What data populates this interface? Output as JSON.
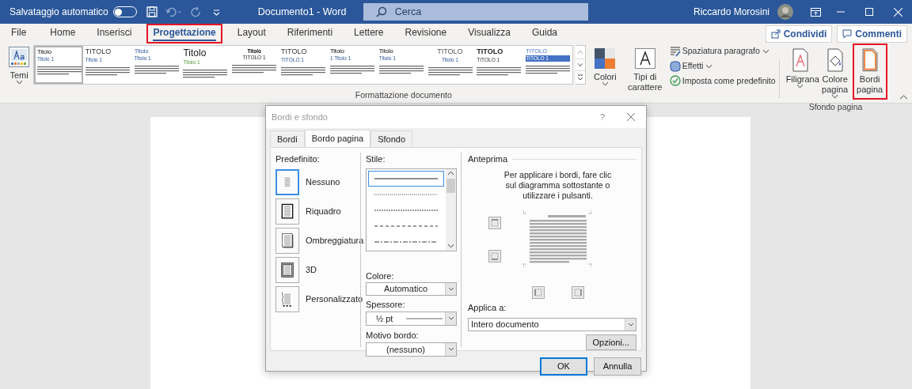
{
  "title_bar": {
    "autosave_label": "Salvataggio automatico",
    "autosave_on": false,
    "document_title": "Documento1 - Word",
    "search_placeholder": "Cerca",
    "user_name": "Riccardo Morosini"
  },
  "ribbon_tabs": [
    {
      "label": "File",
      "selected": false,
      "highlighted": false
    },
    {
      "label": "Home",
      "selected": false,
      "highlighted": false
    },
    {
      "label": "Inserisci",
      "selected": false,
      "highlighted": false
    },
    {
      "label": "Progettazione",
      "selected": true,
      "highlighted": true
    },
    {
      "label": "Layout",
      "selected": false,
      "highlighted": false
    },
    {
      "label": "Riferimenti",
      "selected": false,
      "highlighted": false
    },
    {
      "label": "Lettere",
      "selected": false,
      "highlighted": false
    },
    {
      "label": "Revisione",
      "selected": false,
      "highlighted": false
    },
    {
      "label": "Visualizza",
      "selected": false,
      "highlighted": false
    },
    {
      "label": "Guida",
      "selected": false,
      "highlighted": false
    }
  ],
  "ribbon_actions": [
    {
      "kind": "share",
      "label": "Condividi"
    },
    {
      "kind": "comments",
      "label": "Commenti"
    }
  ],
  "ribbon": {
    "themes_label": "Temi",
    "style_gallery": [
      {
        "kind": "plain",
        "title": "Titolo",
        "subtitle": "Titolo 1",
        "selected": true
      },
      {
        "kind": "caps",
        "title": "TITOLO",
        "subtitle": "Titolo 1",
        "selected": false
      },
      {
        "kind": "blue",
        "title": "Titolo",
        "subtitle": "Titolo 1",
        "selected": false
      },
      {
        "kind": "large",
        "title": "Titolo",
        "subtitle": "Titolo 1",
        "selected": false
      },
      {
        "kind": "small-bold",
        "title": "Titolo",
        "subtitle": "TITOLO 1",
        "selected": false
      },
      {
        "kind": "caps",
        "title": "TITOLO",
        "subtitle": "TITOLO 1",
        "selected": false
      },
      {
        "kind": "plain",
        "title": "Titolo",
        "subtitle": "1 Titolo 1",
        "selected": false
      },
      {
        "kind": "plain",
        "title": "Titolo",
        "subtitle": "Titolo 1",
        "selected": false
      },
      {
        "kind": "caps-centered",
        "title": "TITOLO",
        "subtitle": "Titolo 1",
        "selected": false
      },
      {
        "kind": "caps-bold",
        "title": "TITOLO",
        "subtitle": "TITOLO 1",
        "selected": false
      },
      {
        "kind": "blue-band",
        "title": "TITOLO",
        "subtitle": "TITOLO 1",
        "selected": false
      }
    ],
    "colors_label": "Colori",
    "fonts_label": "Tipi di carattere",
    "paragraph_spacing": "Spaziatura paragrafo",
    "effects": "Effetti",
    "set_default": "Imposta come predefinito",
    "format_group": "Formattazione documento",
    "background_buttons": [
      {
        "kind": "watermark",
        "label": "Filigrana",
        "highlighted": false
      },
      {
        "kind": "page-color",
        "label": "Colore pagina",
        "highlighted": false
      },
      {
        "kind": "page-borders",
        "label": "Bordi pagina",
        "highlighted": true
      }
    ],
    "background_group": "Sfondo pagina"
  },
  "dialog": {
    "title": "Bordi e sfondo",
    "help": "?",
    "tabs": [
      {
        "label": "Bordi",
        "selected": false
      },
      {
        "label": "Bordo pagina",
        "selected": true
      },
      {
        "label": "Sfondo",
        "selected": false
      }
    ],
    "presets_label": "Predefinito:",
    "presets": [
      {
        "kind": "none",
        "label": "Nessuno",
        "selected": true
      },
      {
        "kind": "box",
        "label": "Riquadro",
        "selected": false
      },
      {
        "kind": "shadow",
        "label": "Ombreggiatura",
        "selected": false
      },
      {
        "kind": "raised",
        "label": "3D",
        "selected": false
      },
      {
        "kind": "custom",
        "label": "Personalizzato",
        "selected": false
      }
    ],
    "style_label": "Stile:",
    "line_styles": [
      {
        "kind": "solid",
        "selected": true
      },
      {
        "kind": "dotted",
        "selected": false
      },
      {
        "kind": "fine-dashed",
        "selected": false
      },
      {
        "kind": "dashed",
        "selected": false
      },
      {
        "kind": "dash-dot",
        "selected": false
      }
    ],
    "color_label": "Colore:",
    "color_value": "Automatico",
    "width_label": "Spessore:",
    "width_value": "½ pt",
    "art_label": "Motivo bordo:",
    "art_value": "(nessuno)",
    "preview_label": "Anteprima",
    "preview_hint": "Per applicare i bordi, fare clic sul diagramma sottostante o utilizzare i pulsanti.",
    "apply_label": "Applica a:",
    "apply_value": "Intero documento",
    "options_button": "Opzioni...",
    "ok_button": "OK",
    "cancel_button": "Annulla"
  }
}
